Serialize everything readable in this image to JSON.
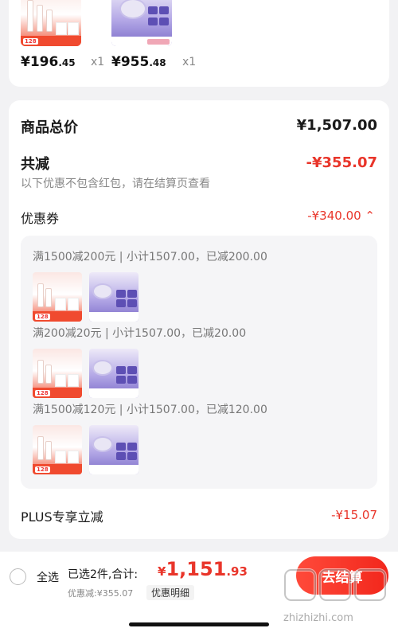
{
  "top_items": [
    {
      "price_int": "¥196",
      "price_dec": ".45",
      "qty": "x1"
    },
    {
      "price_int": "¥955",
      "price_dec": ".48",
      "qty": "x1"
    }
  ],
  "summary": {
    "total_label": "商品总价",
    "total_value": "¥1,507.00",
    "discount_label": "共减",
    "discount_value": "-¥355.07",
    "note": "以下优惠不包含红包，请在结算页查看",
    "coupon_label": "优惠券",
    "coupon_value": "-¥340.00 ⌃"
  },
  "coupon_rules": [
    "满1500减200元 | 小计1507.00，已减200.00",
    "满200减20元 | 小计1507.00，已减20.00",
    "满1500减120元 | 小计1507.00，已减120.00"
  ],
  "plus": {
    "label": "PLUS专享立减",
    "value": "-¥15.07"
  },
  "footer": {
    "select_all": "全选",
    "selected_text": "已选2件,合计:",
    "total_sym": "¥",
    "total_int": "1,151",
    "total_dec": ".93",
    "discount": "优惠减:¥355.07",
    "detail_btn": "优惠明细",
    "checkout": "去结算"
  },
  "watermark": {
    "text": "zhizhizhi.com"
  },
  "colors": {
    "accent_red": "#e9352a",
    "checkout_bg": "#f2271c"
  }
}
